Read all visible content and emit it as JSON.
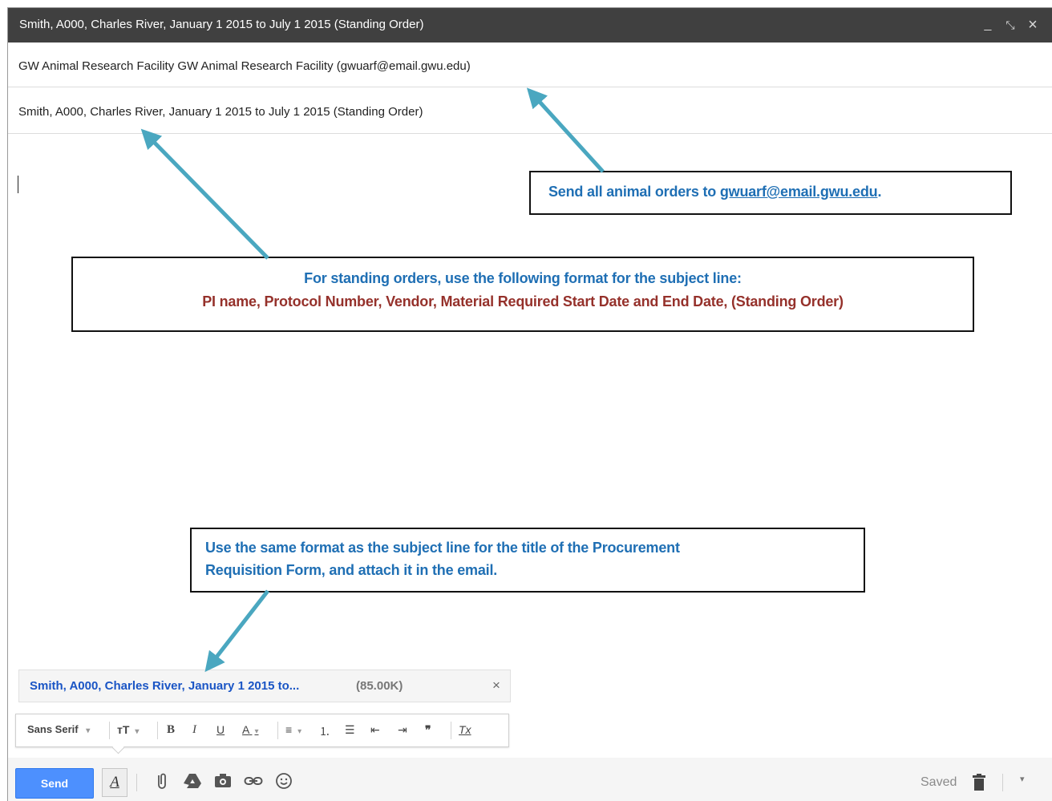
{
  "window": {
    "title": "Smith, A000, Charles River, January 1 2015 to July 1 2015 (Standing Order)",
    "minimize": "_",
    "popout": "⤡",
    "close": "×"
  },
  "compose": {
    "to": "GW Animal Research Facility GW Animal Research Facility (gwuarf@email.gwu.edu)",
    "subject": "Smith, A000, Charles River, January 1 2015 to July 1 2015 (Standing Order)"
  },
  "callouts": {
    "email": {
      "prefix": "Send all animal orders to ",
      "link": "gwuarf@email.gwu.edu",
      "suffix": "."
    },
    "subject_format": {
      "line1": "For standing orders, use the following format for the subject line:",
      "line2": "PI name, Protocol Number, Vendor, Material Required Start Date and End Date, (Standing Order)"
    },
    "attachment": {
      "line1": "Use the same format as the subject line for the title of the Procurement",
      "line2": "Requisition Form, and attach it in the email."
    }
  },
  "attachment": {
    "name": "Smith, A000, Charles River, January 1 2015 to...",
    "size": "(85.00K)",
    "remove": "×"
  },
  "formatting": {
    "font": "Sans Serif",
    "dropdown": "▾",
    "size": "ᴛT",
    "bold": "B",
    "italic": "I",
    "underline": "U",
    "text_color": "A",
    "align": "≡",
    "numbered": "⒈",
    "bulleted": "☰",
    "indent_less": "⇤",
    "indent_more": "⇥",
    "quote": "❞",
    "clear": "Tx"
  },
  "toolbar": {
    "send": "Send",
    "format_toggle": "A",
    "saved": "Saved",
    "more": "▾"
  },
  "colors": {
    "titlebar": "#404040",
    "send": "#4d90fe",
    "callout_blue": "#1f6fb4",
    "callout_red": "#95312b",
    "arrow": "#4aa7c0",
    "attachment_link": "#1a55c5"
  },
  "icons": [
    "attach-icon",
    "drive-icon",
    "photo-icon",
    "link-icon",
    "emoji-icon",
    "trash-icon"
  ]
}
